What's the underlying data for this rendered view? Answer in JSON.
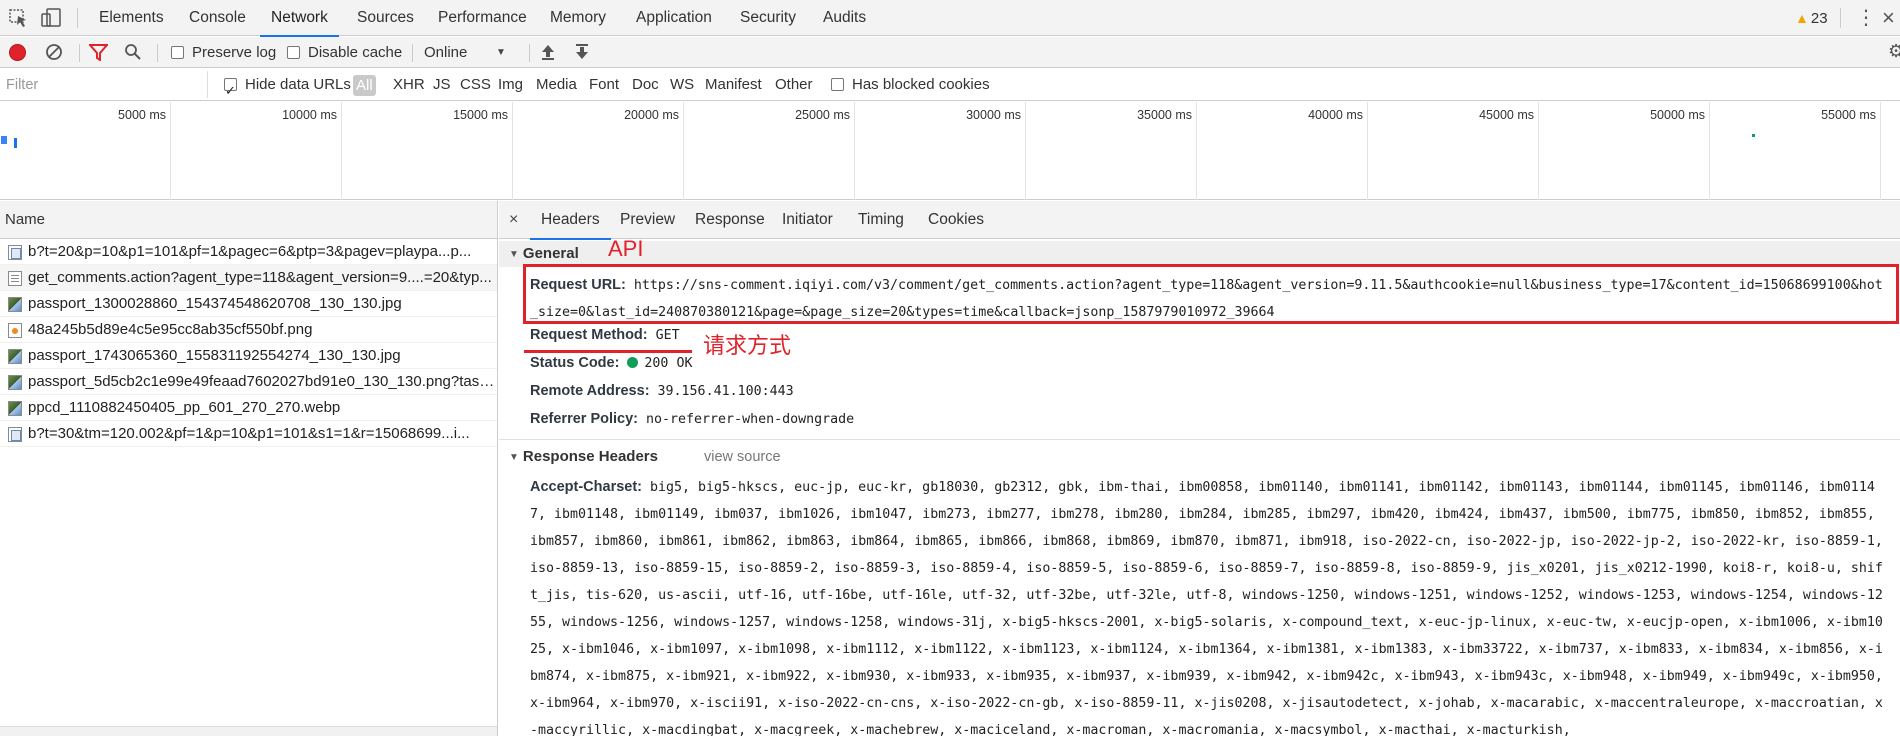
{
  "topbar": {
    "tabs": [
      {
        "label": "Elements"
      },
      {
        "label": "Console"
      },
      {
        "label": "Network",
        "active": true
      },
      {
        "label": "Sources"
      },
      {
        "label": "Performance"
      },
      {
        "label": "Memory"
      },
      {
        "label": "Application"
      },
      {
        "label": "Security"
      },
      {
        "label": "Audits"
      }
    ],
    "warning_count": "23",
    "kebab": "⋮",
    "close": "×"
  },
  "toolbar": {
    "preserve_log": "Preserve log",
    "preserve_log_checked": false,
    "disable_cache": "Disable cache",
    "disable_cache_checked": false,
    "throttle": "Online"
  },
  "filterbar": {
    "placeholder": "Filter",
    "hide_data_urls": "Hide data URLs",
    "hide_data_urls_checked": true,
    "types": [
      "All",
      "XHR",
      "JS",
      "CSS",
      "Img",
      "Media",
      "Font",
      "Doc",
      "WS",
      "Manifest",
      "Other"
    ],
    "selected_type": "All",
    "blocked_cookies": "Has blocked cookies",
    "blocked_cookies_checked": false
  },
  "overview": {
    "ticks": [
      "5000 ms",
      "10000 ms",
      "15000 ms",
      "20000 ms",
      "25000 ms",
      "30000 ms",
      "35000 ms",
      "40000 ms",
      "45000 ms",
      "50000 ms",
      "55000 ms"
    ]
  },
  "requests": {
    "header": "Name",
    "rows": [
      {
        "name": "b?t=20&p=10&p1=101&pf=1&pagec=6&ptp=3&pagev=playpa...p...",
        "icon": "script-icon"
      },
      {
        "name": "get_comments.action?agent_type=118&agent_version=9....=20&typ...",
        "icon": "document-icon"
      },
      {
        "name": "passport_1300028860_154374548620708_130_130.jpg",
        "icon": "image-icon"
      },
      {
        "name": "48a245b5d89e4c5e95cc8ab35cf550bf.png",
        "icon": "png-icon"
      },
      {
        "name": "passport_1743065360_155831192554274_130_130.jpg",
        "icon": "image-icon"
      },
      {
        "name": "passport_5d5cb2c1e99e49feaad7602027bd91e0_130_130.png?taskl...",
        "icon": "image-icon"
      },
      {
        "name": "ppcd_1110882450405_pp_601_270_270.webp",
        "icon": "image-icon"
      },
      {
        "name": "b?t=30&tm=120.002&pf=1&p=10&p1=101&s1=1&r=15068699...i...",
        "icon": "script-icon"
      }
    ]
  },
  "detail": {
    "close": "×",
    "tabs": [
      "Headers",
      "Preview",
      "Response",
      "Initiator",
      "Timing",
      "Cookies"
    ],
    "active_tab": "Headers",
    "general": {
      "title": "General",
      "request_url_key": "Request URL:",
      "request_url": "https://sns-comment.iqiyi.com/v3/comment/get_comments.action?agent_type=118&agent_version=9.11.5&authcookie=null&business_type=17&content_id=15068699100&hot_size=0&last_id=240870380121&page=&page_size=20&types=time&callback=jsonp_1587979010972_39664",
      "request_method_key": "Request Method:",
      "request_method": "GET",
      "status_code_key": "Status Code:",
      "status_code": "200 OK",
      "remote_address_key": "Remote Address:",
      "remote_address": "39.156.41.100:443",
      "referrer_policy_key": "Referrer Policy:",
      "referrer_policy": "no-referrer-when-downgrade"
    },
    "response_headers": {
      "title": "Response Headers",
      "view_source": "view source",
      "accept_charset_key": "Accept-Charset:",
      "accept_charset": "big5, big5-hkscs, euc-jp, euc-kr, gb18030, gb2312, gbk, ibm-thai, ibm00858, ibm01140, ibm01141, ibm01142, ibm01143, ibm01144, ibm01145, ibm01146, ibm01147, ibm01148, ibm01149, ibm037, ibm1026, ibm1047, ibm273, ibm277, ibm278, ibm280, ibm284, ibm285, ibm297, ibm420, ibm424, ibm437, ibm500, ibm775, ibm850, ibm852, ibm855, ibm857, ibm860, ibm861, ibm862, ibm863, ibm864, ibm865, ibm866, ibm868, ibm869, ibm870, ibm871, ibm918, iso-2022-cn, iso-2022-jp, iso-2022-jp-2, iso-2022-kr, iso-8859-1, iso-8859-13, iso-8859-15, iso-8859-2, iso-8859-3, iso-8859-4, iso-8859-5, iso-8859-6, iso-8859-7, iso-8859-8, iso-8859-9, jis_x0201, jis_x0212-1990, koi8-r, koi8-u, shift_jis, tis-620, us-ascii, utf-16, utf-16be, utf-16le, utf-32, utf-32be, utf-32le, utf-8, windows-1250, windows-1251, windows-1252, windows-1253, windows-1254, windows-1255, windows-1256, windows-1257, windows-1258, windows-31j, x-big5-hkscs-2001, x-big5-solaris, x-compound_text, x-euc-jp-linux, x-euc-tw, x-eucjp-open, x-ibm1006, x-ibm1025, x-ibm1046, x-ibm1097, x-ibm1098, x-ibm1112, x-ibm1122, x-ibm1123, x-ibm1124, x-ibm1364, x-ibm1381, x-ibm1383, x-ibm33722, x-ibm737, x-ibm833, x-ibm834, x-ibm856, x-ibm874, x-ibm875, x-ibm921, x-ibm922, x-ibm930, x-ibm933, x-ibm935, x-ibm937, x-ibm939, x-ibm942, x-ibm942c, x-ibm943, x-ibm943c, x-ibm948, x-ibm949, x-ibm949c, x-ibm950, x-ibm964, x-ibm970, x-iscii91, x-iso-2022-cn-cns, x-iso-2022-cn-gb, x-iso-8859-11, x-jis0208, x-jisautodetect, x-johab, x-macarabic, x-maccentraleurope, x-maccroatian, x-maccyrillic, x-macdingbat, x-macgreek, x-machebrew, x-maciceland, x-macroman, x-macromania, x-macsymbol, x-macthai, x-macturkish,"
    }
  },
  "annotations": {
    "api_label": "API",
    "method_label": "请求方式"
  },
  "colors": {
    "accent": "#1a73e8",
    "record": "#e0232a",
    "annotation": "#e0232a",
    "status_ok": "#0f9d58"
  }
}
